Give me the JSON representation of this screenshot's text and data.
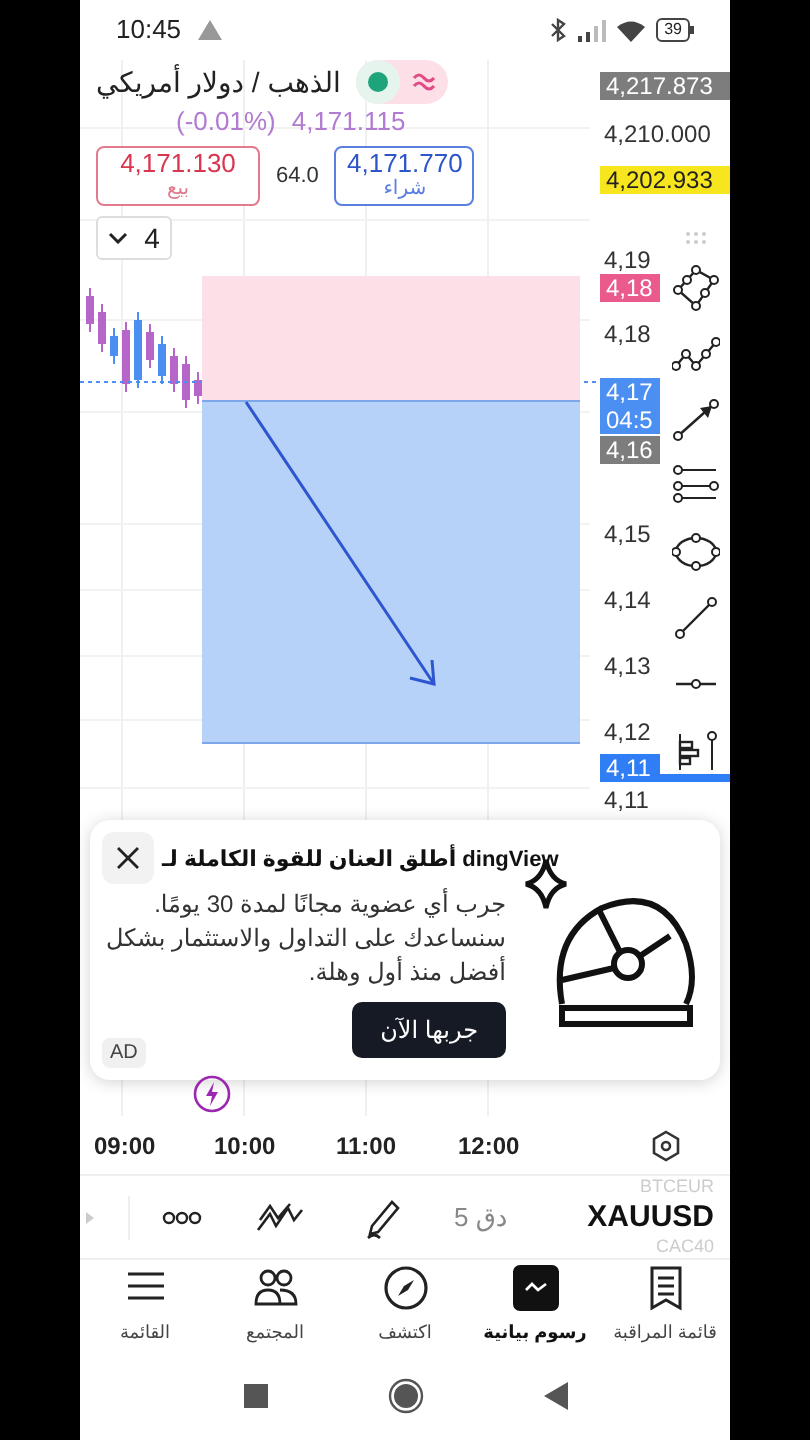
{
  "status_bar": {
    "time": "10:45",
    "battery": "39"
  },
  "symbol": {
    "title": "الذهب / دولار أمريكي",
    "change": "(-0.01%)",
    "price": "4,171.115"
  },
  "quote": {
    "sell_price": "4,171.130",
    "sell_label": "بيع",
    "spread": "64.0",
    "buy_price": "4,171.770",
    "buy_label": "شراء"
  },
  "quantity": {
    "value": "4"
  },
  "price_axis": [
    {
      "kind": "badge",
      "text": "4,217.873",
      "color": "#7d7d7d"
    },
    {
      "kind": "label",
      "text": "4,210.000"
    },
    {
      "kind": "badge",
      "text": "4,202.933",
      "color": "#f7e51d"
    },
    {
      "kind": "label",
      "text": "4,19"
    },
    {
      "kind": "badge",
      "text": "4,18",
      "color": "#ea5a8c"
    },
    {
      "kind": "label",
      "text": "4,18"
    },
    {
      "kind": "badge",
      "text": "4,17",
      "sub": "04:5",
      "color": "#4c8ff2"
    },
    {
      "kind": "badge",
      "text": "4,16",
      "color": "#7d7d7d"
    },
    {
      "kind": "label",
      "text": "4,15"
    },
    {
      "kind": "label",
      "text": "4,14"
    },
    {
      "kind": "label",
      "text": "4,13"
    },
    {
      "kind": "label",
      "text": "4,12"
    },
    {
      "kind": "badge",
      "text": "4,11",
      "color": "#2f7ef5"
    },
    {
      "kind": "label",
      "text": "4,11"
    }
  ],
  "ad": {
    "title": "أطلق العنان للقوة الكاملة لـ dingView",
    "lines": [
      "جرب أي عضوية مجانًا لمدة 30 يومًا.",
      "سنساعدك على التداول والاستثمار بشكل أفضل منذ أول وهلة."
    ],
    "button": "جربها الآن",
    "tag": "AD"
  },
  "time_axis": [
    "12:00",
    "11:00",
    "10:00",
    "09:00"
  ],
  "toolbar": {
    "interval": "5 دق",
    "symbol": "XAUUSD",
    "prev_symbol": "BTCEUR",
    "next_symbol": "CAC40"
  },
  "nav": [
    {
      "kind": "watchlist",
      "label": "قائمة المراقبة",
      "selected": false
    },
    {
      "kind": "charts",
      "label": "رسوم بيانية",
      "selected": true
    },
    {
      "kind": "explore",
      "label": "اكتشف",
      "selected": false
    },
    {
      "kind": "community",
      "label": "المجتمع",
      "selected": false
    },
    {
      "kind": "menu",
      "label": "القائمة",
      "selected": false
    }
  ]
}
